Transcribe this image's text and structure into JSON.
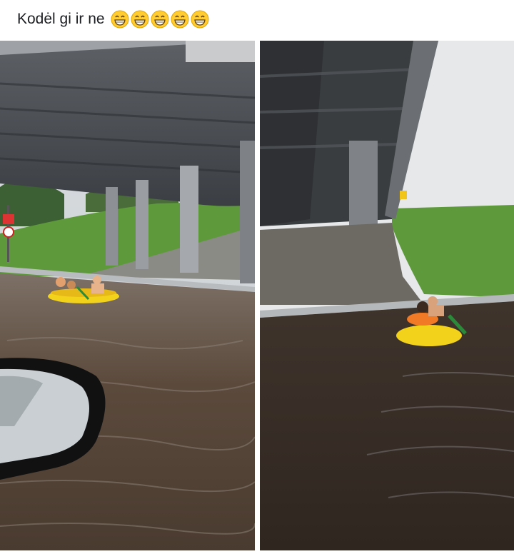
{
  "post": {
    "caption": "Kodėl gi ir ne",
    "emoji_count": 5,
    "emoji_icon": "grinning-face-with-smiling-eyes-icon"
  },
  "photos": [
    {
      "name": "flooded-underpass-photo-left",
      "description_icon": "photo-icon"
    },
    {
      "name": "flooded-underpass-photo-right",
      "description_icon": "photo-icon"
    }
  ],
  "colors": {
    "water": "#4e3f33",
    "grass": "#5e9a3c",
    "bridge": "#4a4d52",
    "raft_yellow": "#f2d21a"
  }
}
